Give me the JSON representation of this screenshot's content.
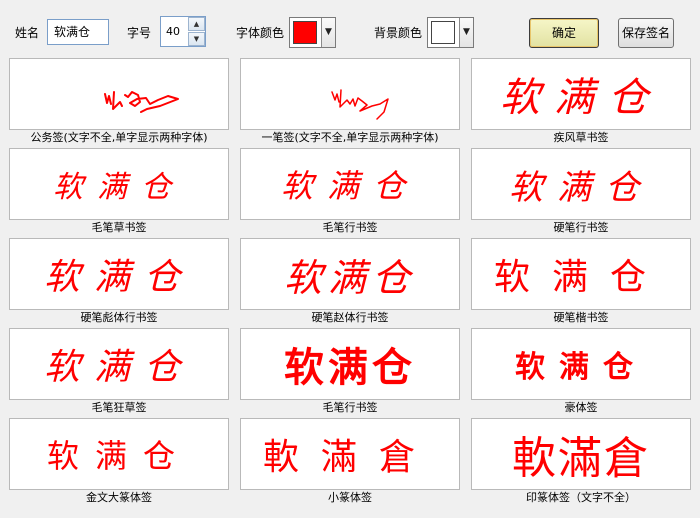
{
  "toolbar": {
    "name_label": "姓名",
    "name_value": "软满仓",
    "size_label": "字号",
    "size_value": "40",
    "font_color_label": "字体颜色",
    "font_color": "#ff0000",
    "bg_color_label": "背景颜色",
    "bg_color": "#ffffff",
    "ok_label": "确定",
    "save_label": "保存签名"
  },
  "signatures": [
    {
      "caption": "公务签(文字不全,单字显示两种字体)",
      "text": ""
    },
    {
      "caption": "一笔签(文字不全,单字显示两种字体)",
      "text": ""
    },
    {
      "caption": "疾风草书签",
      "text": "软满仓"
    },
    {
      "caption": "毛笔草书签",
      "text": "软满仓"
    },
    {
      "caption": "毛笔行书签",
      "text": "软满仓"
    },
    {
      "caption": "硬笔行书签",
      "text": "软满仓"
    },
    {
      "caption": "硬笔彪体行书签",
      "text": "软满仓"
    },
    {
      "caption": "硬笔赵体行书签",
      "text": "软满仓"
    },
    {
      "caption": "硬笔楷书签",
      "text": "软满仓"
    },
    {
      "caption": "毛笔狂草签",
      "text": "软满仓"
    },
    {
      "caption": "毛笔行书签",
      "text": "软满仓"
    },
    {
      "caption": "豪体签",
      "text": "软满仓"
    },
    {
      "caption": "金文大篆体签",
      "text": "软满仓"
    },
    {
      "caption": "小篆体签",
      "text": "軟滿倉"
    },
    {
      "caption": "印篆体签（文字不全）",
      "text": "軟滿倉"
    }
  ]
}
